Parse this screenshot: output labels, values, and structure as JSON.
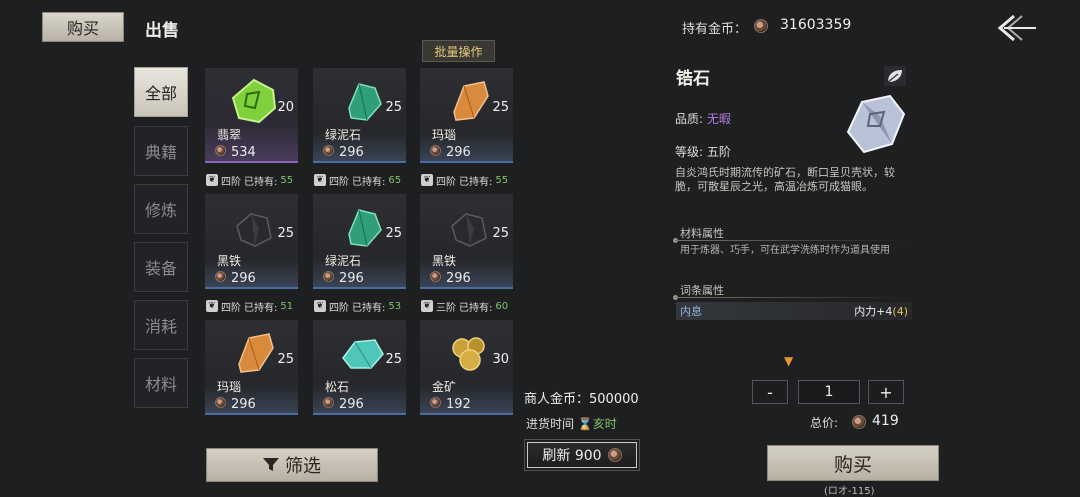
{
  "header": {
    "tab_buy": "购买",
    "tab_sell": "出售",
    "gold_label": "持有金币：",
    "gold_value": "31603359"
  },
  "batch_label": "批量操作",
  "categories": [
    "全部",
    "典籍",
    "修炼",
    "装备",
    "消耗",
    "材料"
  ],
  "items": [
    {
      "name": "翡翠",
      "count": "20",
      "price": "534",
      "gem": "jade"
    },
    {
      "name": "绿泥石",
      "count": "25",
      "price": "296",
      "gem": "green"
    },
    {
      "name": "玛瑙",
      "count": "25",
      "price": "296",
      "gem": "agate"
    },
    {
      "name": "黑铁",
      "count": "25",
      "price": "296",
      "gem": "iron"
    },
    {
      "name": "绿泥石",
      "count": "25",
      "price": "296",
      "gem": "green"
    },
    {
      "name": "黑铁",
      "count": "25",
      "price": "296",
      "gem": "iron"
    },
    {
      "name": "玛瑙",
      "count": "25",
      "price": "296",
      "gem": "agate"
    },
    {
      "name": "松石",
      "count": "25",
      "price": "296",
      "gem": "turquoise"
    },
    {
      "name": "金矿",
      "count": "30",
      "price": "192",
      "gem": "gold"
    }
  ],
  "tiers": [
    {
      "tier": "四阶",
      "held_label": "已持有:",
      "held": "55"
    },
    {
      "tier": "四阶",
      "held_label": "已持有:",
      "held": "65"
    },
    {
      "tier": "四阶",
      "held_label": "已持有:",
      "held": "55"
    },
    {
      "tier": "四阶",
      "held_label": "已持有:",
      "held": "51"
    },
    {
      "tier": "四阶",
      "held_label": "已持有:",
      "held": "53"
    },
    {
      "tier": "三阶",
      "held_label": "已持有:",
      "held": "60"
    }
  ],
  "merchant": {
    "gold_text": "商人金币：500000",
    "restock_label": "进货时间",
    "restock_time": "亥时",
    "refresh_label": "刷新 900"
  },
  "filter_label": "筛选",
  "detail": {
    "title": "锆石",
    "quality_label": "品质:",
    "quality_value": "无暇",
    "grade": "等级: 五阶",
    "description": "自炎鸿氏时期流传的矿石，断口呈贝壳状，较脆，可散星辰之光，高温冶炼可成猫眼。",
    "material_head": "材料属性",
    "material_desc": "用于炼器、巧手，可在武学洗练时作为道具使用",
    "entry_head": "词条属性",
    "attr_key": "内息",
    "attr_value": "内力+4",
    "attr_bonus": "(4)"
  },
  "purchase": {
    "minus": "-",
    "quantity": "1",
    "plus": "+",
    "total_label": "总价:",
    "total_value": "419",
    "buy_label": "购买",
    "buy_note": "(ロオ-115)"
  },
  "colors": {
    "accent_gold": "#e8c97a",
    "held_green": "#7fc46b",
    "quality_purple": "#b47ee0",
    "attr_blue": "#8fb8e6"
  }
}
